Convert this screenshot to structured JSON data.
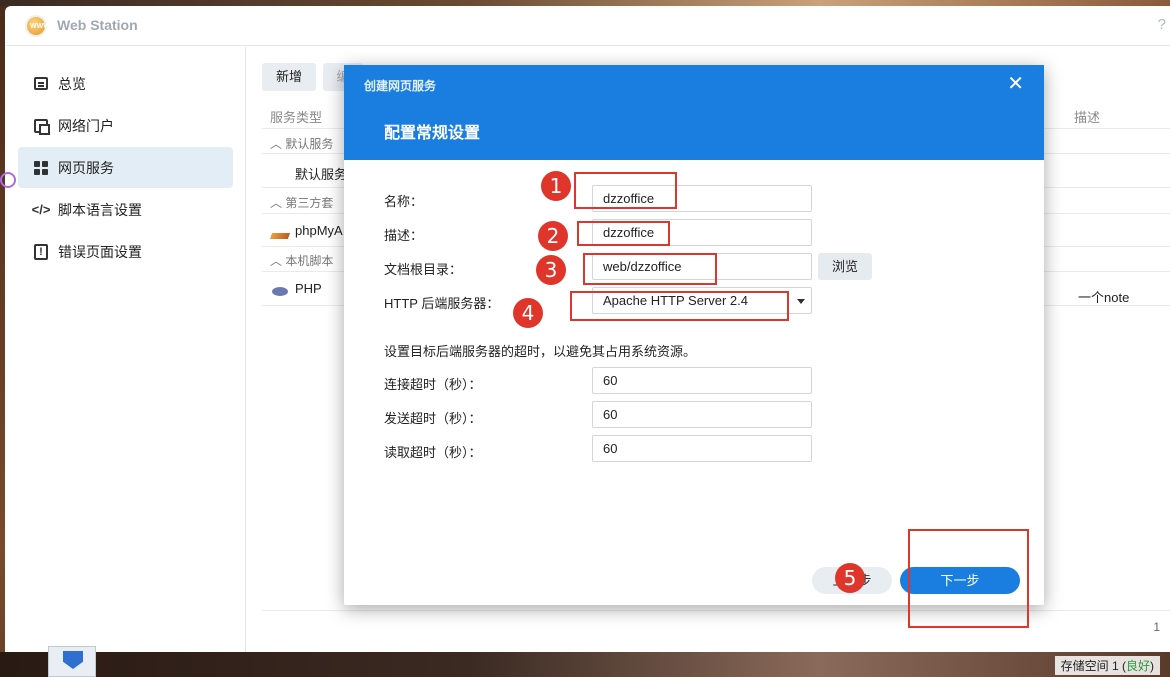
{
  "window": {
    "title": "Web Station",
    "help": "?"
  },
  "sidebar": {
    "items": [
      {
        "label": "总览",
        "icon": "overview-icon"
      },
      {
        "label": "网络门户",
        "icon": "portal-icon"
      },
      {
        "label": "网页服务",
        "icon": "web-service-icon",
        "active": true
      },
      {
        "label": "脚本语言设置",
        "icon": "code-icon"
      },
      {
        "label": "错误页面设置",
        "icon": "error-page-icon"
      }
    ]
  },
  "content": {
    "toolbar": {
      "new_label": "新增",
      "edit_label": "编"
    },
    "columns": {
      "service_type": "服务类型",
      "description": "描述"
    },
    "groups": [
      {
        "label": "默认服务",
        "items": [
          "默认服务"
        ]
      },
      {
        "label": "第三方套",
        "items": [
          "phpMyA"
        ]
      },
      {
        "label": "本机脚本",
        "items": [
          "PHP"
        ]
      }
    ],
    "php_note": "一个note",
    "page_indicator": "1"
  },
  "dialog": {
    "small_title": "创建网页服务",
    "title": "配置常规设置",
    "fields": {
      "name": {
        "label": "名称：",
        "value": "dzzoffice"
      },
      "description": {
        "label": "描述：",
        "value": "dzzoffice"
      },
      "docroot": {
        "label": "文档根目录：",
        "value": "web/dzzoffice",
        "browse": "浏览"
      },
      "backend": {
        "label": "HTTP 后端服务器：",
        "value": "Apache HTTP Server 2.4"
      }
    },
    "hint": "设置目标后端服务器的超时，以避免其占用系统资源。",
    "timeouts": {
      "connect": {
        "label": "连接超时（秒）：",
        "value": "60"
      },
      "send": {
        "label": "发送超时（秒）：",
        "value": "60"
      },
      "read": {
        "label": "读取超时（秒）：",
        "value": "60"
      }
    },
    "buttons": {
      "prev": "上一步",
      "next": "下一步"
    }
  },
  "annotations": [
    "1",
    "2",
    "3",
    "4",
    "5"
  ],
  "taskbar": {
    "storage_label": "存储空间 1 (",
    "storage_status": "良好",
    "storage_close": ")"
  },
  "colors": {
    "accent": "#1a7de0",
    "annotation": "#e0352b",
    "active_bg": "#e3edf6"
  }
}
